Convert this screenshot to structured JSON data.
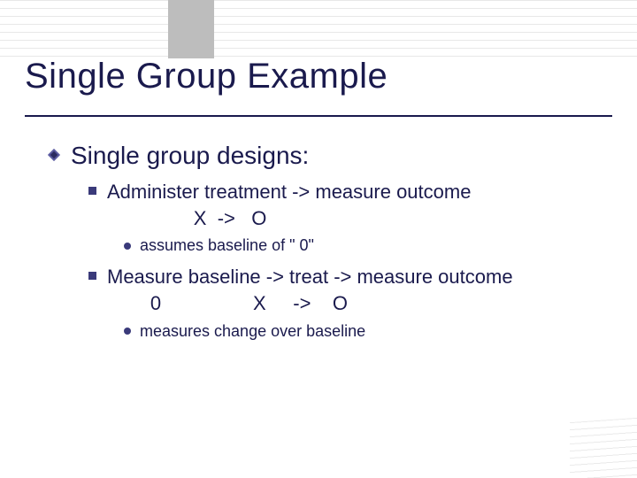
{
  "title": "Single Group Example",
  "bullets": {
    "lvl1": {
      "text": "Single group designs:"
    },
    "item1": {
      "line1": "Administer treatment -> measure outcome",
      "line2": "                X  ->   O",
      "sub": "assumes baseline of \" 0\""
    },
    "item2": {
      "line1": "Measure baseline -> treat -> measure outcome",
      "line2": "        0                 X     ->    O",
      "sub": "measures change over baseline"
    }
  }
}
